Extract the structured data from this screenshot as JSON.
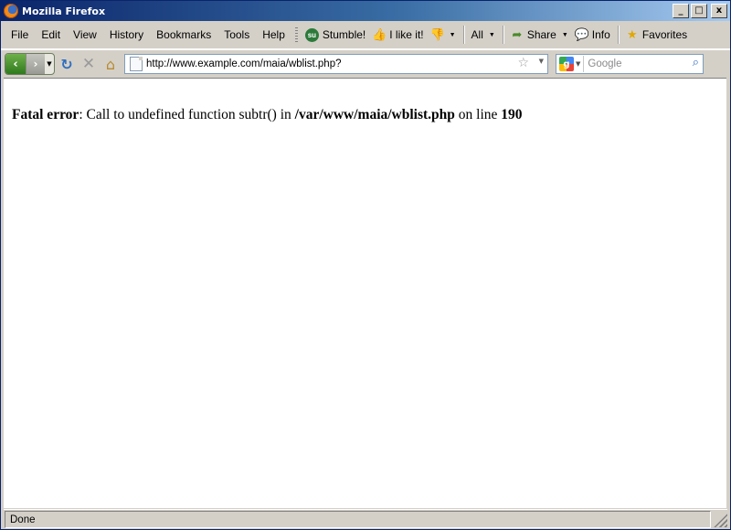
{
  "window": {
    "title": "Mozilla Firefox"
  },
  "window_buttons": {
    "minimize": "_",
    "maximize": "□",
    "close": "x"
  },
  "menu": {
    "file": "File",
    "edit": "Edit",
    "view": "View",
    "history": "History",
    "bookmarks": "Bookmarks",
    "tools": "Tools",
    "help": "Help"
  },
  "toolbar": {
    "stumble": "Stumble!",
    "like": "I like it!",
    "all": "All",
    "share": "Share",
    "info": "Info",
    "favorites": "Favorites"
  },
  "nav": {
    "url": "http://www.example.com/maia/wblist.php?",
    "search_placeholder": "Google"
  },
  "page": {
    "error_label": "Fatal error",
    "error_message": ": Call to undefined function subtr() in ",
    "error_path": "/var/www/maia/wblist.php",
    "error_on_line": " on line ",
    "error_line": "190"
  },
  "status": {
    "text": "Done"
  },
  "colors": {
    "titlebar_start": "#0a246a",
    "titlebar_end": "#a6caf0",
    "chrome": "#d4d0c8"
  }
}
